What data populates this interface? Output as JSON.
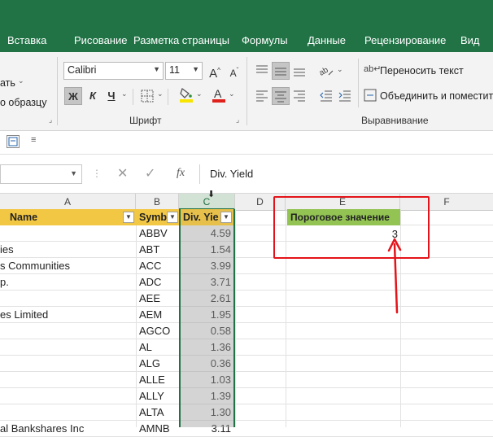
{
  "tabs": [
    "Вставка",
    "Рисование",
    "Разметка страницы",
    "Формулы",
    "Данные",
    "Рецензирование",
    "Вид"
  ],
  "clipboard": {
    "paste_partial": "ать",
    "format_painter_partial": "о образцу"
  },
  "font": {
    "group_label": "Шрифт",
    "name": "Calibri",
    "size": "11",
    "bold": "Ж",
    "italic": "К",
    "underline": "Ч",
    "grow": "A",
    "shrink": "A",
    "fill_color": "#f7e400",
    "font_color": "#e0201b"
  },
  "alignment": {
    "group_label": "Выравнивание",
    "wrap_text": "Переносить текст",
    "merge_center": "Объединить и поместить"
  },
  "formula_bar": {
    "fx": "fx",
    "content": "Div. Yield"
  },
  "columns": [
    "A",
    "B",
    "C",
    "D",
    "E",
    "F"
  ],
  "headers": {
    "name": "Name",
    "symbol": "Symb",
    "yield": "Div. Yie"
  },
  "threshold": {
    "label": "Пороговое значение",
    "value": "3"
  },
  "rows": [
    {
      "name": "",
      "symbol": "ABBV",
      "yield": "4.59"
    },
    {
      "name": "ies",
      "symbol": "ABT",
      "yield": "1.54"
    },
    {
      "name": "s Communities",
      "symbol": "ACC",
      "yield": "3.99"
    },
    {
      "name": "p.",
      "symbol": "ADC",
      "yield": "3.71"
    },
    {
      "name": "",
      "symbol": "AEE",
      "yield": "2.61"
    },
    {
      "name": "es Limited",
      "symbol": "AEM",
      "yield": "1.95"
    },
    {
      "name": "",
      "symbol": "AGCO",
      "yield": "0.58"
    },
    {
      "name": "",
      "symbol": "AL",
      "yield": "1.36"
    },
    {
      "name": "",
      "symbol": "ALG",
      "yield": "0.36"
    },
    {
      "name": "",
      "symbol": "ALLE",
      "yield": "1.03"
    },
    {
      "name": "",
      "symbol": "ALLY",
      "yield": "1.39"
    },
    {
      "name": "",
      "symbol": "ALTA",
      "yield": "1.30"
    },
    {
      "name": "al Bankshares Inc",
      "symbol": "AMNB",
      "yield": "3.11"
    }
  ],
  "annotation_color": "#e4131a"
}
